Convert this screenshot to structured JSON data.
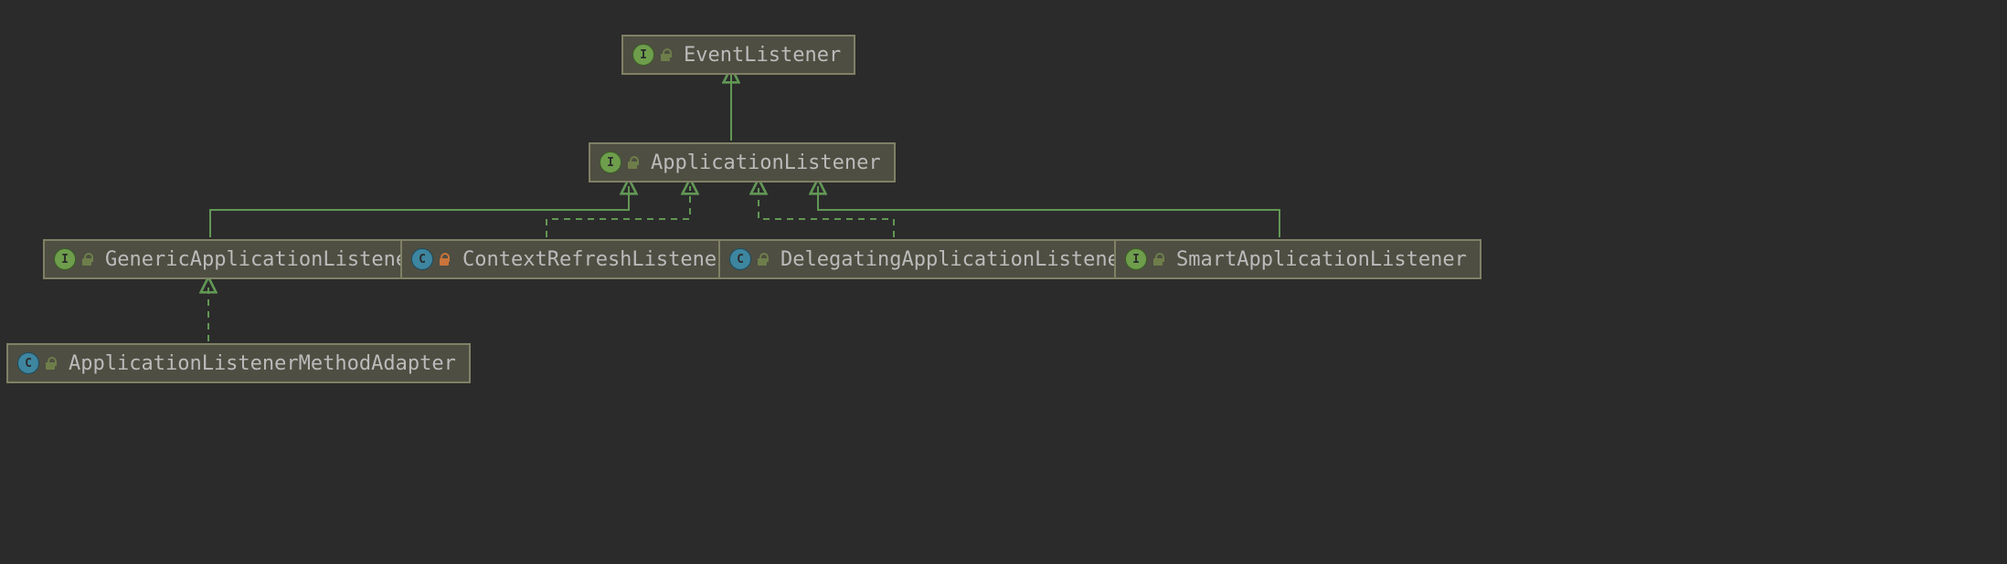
{
  "diagram": {
    "colors": {
      "background": "#2b2b2b",
      "nodeFill": "#4e4e42",
      "nodeBorder": "#808066",
      "text": "#bbbbbb",
      "interfaceBadge": "#6e9e4c",
      "classBadge": "#3e86a0",
      "edge": "#629755",
      "lockIcon": "#c9743b"
    },
    "nodes": {
      "eventListener": {
        "label": "EventListener",
        "kind": "I",
        "visibility": "unlock"
      },
      "applicationListener": {
        "label": "ApplicationListener",
        "kind": "I",
        "visibility": "unlock"
      },
      "genericApplicationListener": {
        "label": "GenericApplicationListener",
        "kind": "I",
        "visibility": "unlock"
      },
      "contextRefreshListener": {
        "label": "ContextRefreshListener",
        "kind": "C",
        "visibility": "lock"
      },
      "delegatingApplicationListener": {
        "label": "DelegatingApplicationListener",
        "kind": "C",
        "visibility": "unlock"
      },
      "smartApplicationListener": {
        "label": "SmartApplicationListener",
        "kind": "I",
        "visibility": "unlock"
      },
      "applicationListenerMethodAdapter": {
        "label": "ApplicationListenerMethodAdapter",
        "kind": "C",
        "visibility": "unlock"
      }
    },
    "edges": [
      {
        "from": "applicationListener",
        "to": "eventListener",
        "style": "solid"
      },
      {
        "from": "genericApplicationListener",
        "to": "applicationListener",
        "style": "solid"
      },
      {
        "from": "contextRefreshListener",
        "to": "applicationListener",
        "style": "dashed"
      },
      {
        "from": "delegatingApplicationListener",
        "to": "applicationListener",
        "style": "dashed"
      },
      {
        "from": "smartApplicationListener",
        "to": "applicationListener",
        "style": "solid"
      },
      {
        "from": "applicationListenerMethodAdapter",
        "to": "genericApplicationListener",
        "style": "dashed"
      }
    ]
  }
}
